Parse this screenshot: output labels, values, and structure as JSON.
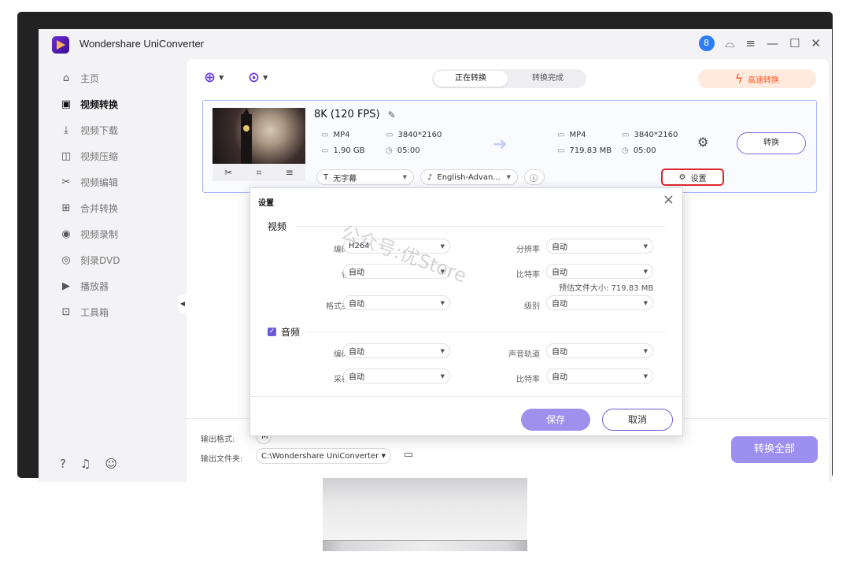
{
  "app": {
    "title": "Wondershare UniConverter"
  },
  "window_controls": {
    "user_initial": "8",
    "support": "⌓",
    "menu": "≡",
    "minimize": "—",
    "maximize": "☐",
    "close": "✕"
  },
  "sidebar": {
    "items": [
      {
        "label": "主页",
        "icon": "home-icon",
        "glyph": "⌂"
      },
      {
        "label": "视频转换",
        "icon": "convert-icon",
        "glyph": "▣",
        "active": true
      },
      {
        "label": "视频下载",
        "icon": "download-icon",
        "glyph": "⤓"
      },
      {
        "label": "视频压缩",
        "icon": "compress-icon",
        "glyph": "◫"
      },
      {
        "label": "视频编辑",
        "icon": "scissors-icon",
        "glyph": "✂"
      },
      {
        "label": "合并转换",
        "icon": "merge-icon",
        "glyph": "⊞"
      },
      {
        "label": "视频录制",
        "icon": "record-icon",
        "glyph": "◉"
      },
      {
        "label": "刻录DVD",
        "icon": "dvd-icon",
        "glyph": "◎"
      },
      {
        "label": "播放器",
        "icon": "player-icon",
        "glyph": "▶"
      },
      {
        "label": "工具箱",
        "icon": "toolbox-icon",
        "glyph": "⊡"
      }
    ],
    "bottom_icons": [
      "help-icon",
      "bell-icon",
      "feedback-icon"
    ]
  },
  "toolbar": {
    "tab_converting": "正在转换",
    "tab_finished": "转换完成",
    "high_speed": "高速转换"
  },
  "file": {
    "name": "8K (120 FPS)",
    "source": {
      "format": "MP4",
      "resolution": "3840*2160",
      "size": "1.90 GB",
      "duration": "05:00"
    },
    "target": {
      "format": "MP4",
      "resolution": "3840*2160",
      "size": "719.83 MB",
      "duration": "05:00"
    },
    "convert_label": "转换",
    "subtitle": "无字幕",
    "audio": "English-Advan...",
    "settings_label": "设置"
  },
  "bottom": {
    "output_format_label": "输出格式:",
    "output_format_value": "M",
    "output_folder_label": "输出文件夹:",
    "output_folder_value": "C:\\Wondershare UniConverter :",
    "convert_all": "转换全部"
  },
  "dialog": {
    "title": "设置",
    "video_section": "视频",
    "audio_section": "音频",
    "video_fields": {
      "encoder_label": "编码器",
      "encoder_value": "H264",
      "resolution_label": "分辨率",
      "resolution_value": "自动",
      "framerate_label": "帧率",
      "framerate_value": "自动",
      "bitrate_label": "比特率",
      "bitrate_value": "自动",
      "estimate": "预估文件大小: 719.83 MB",
      "format_label": "格式类型",
      "format_value": "自动",
      "level_label": "级别",
      "level_value": "自动"
    },
    "audio_fields": {
      "encoder_label": "编码器",
      "encoder_value": "自动",
      "channel_label": "声音轨道",
      "channel_value": "自动",
      "samplerate_label": "采样率",
      "samplerate_value": "自动",
      "bitrate_label": "比特率",
      "bitrate_value": "自动"
    },
    "save": "保存",
    "cancel": "取消",
    "watermark": "公众号:优Store"
  },
  "colors": {
    "accent": "#6c5bd8",
    "high_speed": "#ff5b2a",
    "settings_highlight": "#e0272b"
  }
}
